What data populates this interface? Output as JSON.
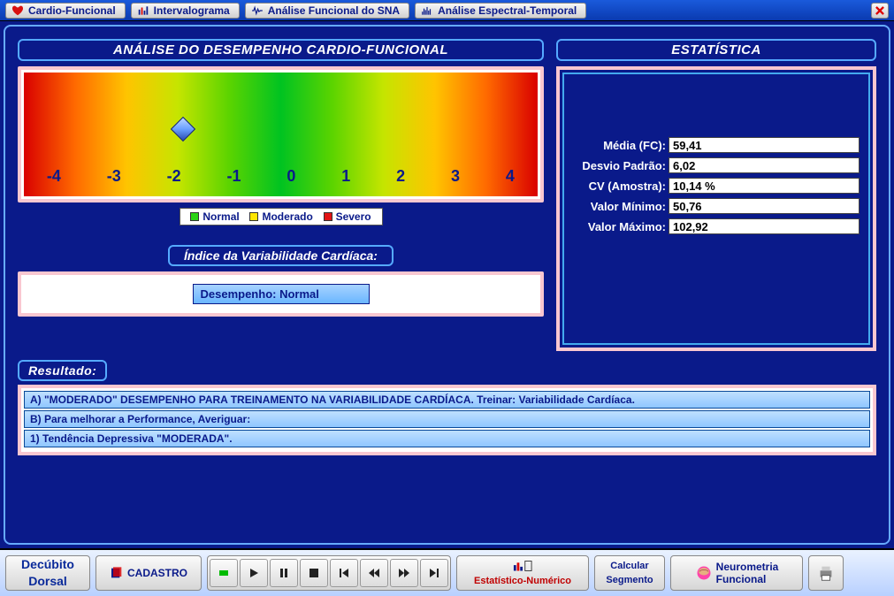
{
  "tabs": {
    "t1": "Cardio-Funcional",
    "t2": "Intervalograma",
    "t3": "Análise Funcional do SNA",
    "t4": "Análise Espectral-Temporal"
  },
  "analysis": {
    "title": "ANÁLISE DO DESEMPENHO CARDIO-FUNCIONAL",
    "ticks": [
      "-4",
      "-3",
      "-2",
      "-1",
      "0",
      "1",
      "2",
      "3",
      "4"
    ],
    "marker_position_pct": 31,
    "legend": {
      "normal": "Normal",
      "moderado": "Moderado",
      "severo": "Severo"
    },
    "legend_colors": {
      "normal": "#2bd415",
      "moderado": "#ffe600",
      "severo": "#e21414"
    },
    "subheader": "Índice da Variabilidade Cardíaca:",
    "performance": "Desempenho: Normal"
  },
  "stats": {
    "title": "ESTATÍSTICA",
    "rows": {
      "media_label": "Média (FC):",
      "media_val": "59,41",
      "dp_label": "Desvio Padrão:",
      "dp_val": "6,02",
      "cv_label": "CV (Amostra):",
      "cv_val": "10,14 %",
      "min_label": "Valor Mínimo:",
      "min_val": "50,76",
      "max_label": "Valor Máximo:",
      "max_val": "102,92"
    }
  },
  "result": {
    "title": "Resultado:",
    "lines": {
      "a": "A) \"MODERADO\" DESEMPENHO PARA TREINAMENTO NA VARIABILIDADE CARDÍACA. Treinar: Variabilidade Cardíaca.",
      "b": "B) Para melhorar a Performance, Averiguar:",
      "c": "1) Tendência Depressiva \"MODERADA\"."
    }
  },
  "bottom": {
    "mode_l1": "Decúbito",
    "mode_l2": "Dorsal",
    "cadastro": "CADASTRO",
    "stat_num": "Estatístico-Numérico",
    "calc_l1": "Calcular",
    "calc_l2": "Segmento",
    "neuro_l1": "Neurometria",
    "neuro_l2": "Funcional"
  }
}
